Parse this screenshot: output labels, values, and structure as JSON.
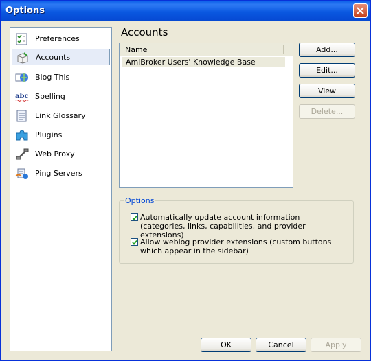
{
  "window": {
    "title": "Options"
  },
  "sidebar": {
    "items": [
      {
        "label": "Preferences",
        "icon": "preferences-icon"
      },
      {
        "label": "Accounts",
        "icon": "accounts-icon",
        "selected": true
      },
      {
        "label": "Blog This",
        "icon": "blog-this-icon"
      },
      {
        "label": "Spelling",
        "icon": "spelling-icon"
      },
      {
        "label": "Link Glossary",
        "icon": "link-glossary-icon"
      },
      {
        "label": "Plugins",
        "icon": "plugins-icon"
      },
      {
        "label": "Web Proxy",
        "icon": "web-proxy-icon"
      },
      {
        "label": "Ping Servers",
        "icon": "ping-servers-icon"
      }
    ]
  },
  "main": {
    "heading": "Accounts",
    "list": {
      "column": "Name",
      "rows": [
        "AmiBroker Users' Knowledge Base"
      ]
    },
    "buttons": {
      "add": "Add...",
      "edit": "Edit...",
      "view": "View",
      "delete": "Delete..."
    },
    "options": {
      "title": "Options",
      "items": [
        {
          "label": "Automatically update account information (categories, links, capabilities, and provider extensions)",
          "checked": true
        },
        {
          "label": "Allow weblog provider extensions (custom buttons which appear in the sidebar)",
          "checked": true
        }
      ]
    }
  },
  "footer": {
    "ok": "OK",
    "cancel": "Cancel",
    "apply": "Apply"
  }
}
